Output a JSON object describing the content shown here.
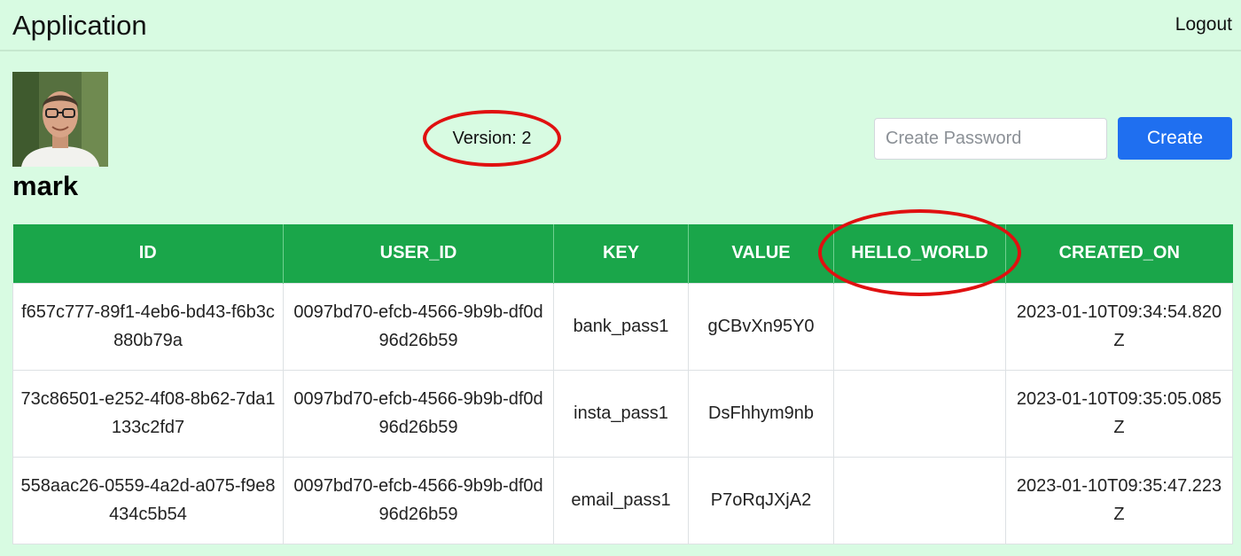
{
  "header": {
    "app_title": "Application",
    "logout_label": "Logout"
  },
  "profile": {
    "username": "mark",
    "avatar_icon": "user-photo"
  },
  "version": {
    "label": "Version: 2"
  },
  "create_form": {
    "placeholder": "Create Password",
    "value": "",
    "button_label": "Create"
  },
  "colors": {
    "background": "#d8fbe2",
    "table_header": "#1aa64a",
    "button": "#1f6ff0",
    "annotation": "#e01010"
  },
  "table": {
    "columns": [
      "ID",
      "USER_ID",
      "KEY",
      "VALUE",
      "HELLO_WORLD",
      "CREATED_ON"
    ],
    "rows": [
      {
        "id": "f657c777-89f1-4eb6-bd43-f6b3c880b79a",
        "user_id": "0097bd70-efcb-4566-9b9b-df0d96d26b59",
        "key": "bank_pass1",
        "value": "gCBvXn95Y0",
        "hello_world": "",
        "created_on": "2023-01-10T09:34:54.820Z"
      },
      {
        "id": "73c86501-e252-4f08-8b62-7da1133c2fd7",
        "user_id": "0097bd70-efcb-4566-9b9b-df0d96d26b59",
        "key": "insta_pass1",
        "value": "DsFhhym9nb",
        "hello_world": "",
        "created_on": "2023-01-10T09:35:05.085Z"
      },
      {
        "id": "558aac26-0559-4a2d-a075-f9e8434c5b54",
        "user_id": "0097bd70-efcb-4566-9b9b-df0d96d26b59",
        "key": "email_pass1",
        "value": "P7oRqJXjA2",
        "hello_world": "",
        "created_on": "2023-01-10T09:35:47.223Z"
      }
    ]
  }
}
